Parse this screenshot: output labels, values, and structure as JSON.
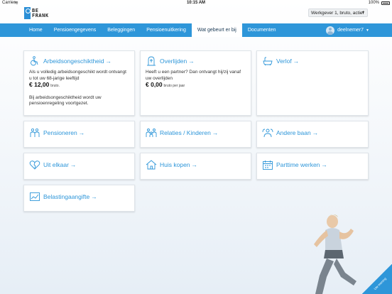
{
  "status_bar": {
    "carrier": "Carrier",
    "time": "10:15 AM",
    "battery": "100%"
  },
  "logo": {
    "line1": "BE",
    "line2": "FRANK"
  },
  "employer_select": {
    "value": "Werkgever 1, bruto, actief"
  },
  "nav": {
    "items": [
      "Home",
      "Pensioengegevens",
      "Beleggingen",
      "Pensioenuitkering",
      "Wat gebeurt er bij",
      "Documenten"
    ],
    "active_index": 4,
    "user": "deelnemer7"
  },
  "cards": {
    "arbeidsongeschiktheid": {
      "title": "Arbeidsongeschiktheid",
      "text1": "Als u volledig arbeidsongeschikt wordt ontvangt u tot uw 68-jarige leeftijd",
      "amount": "€ 12,00",
      "amount_note": "bruto.",
      "text2": "Bij arbeidsongeschiktheid wordt uw pensioenregeling voortgezet."
    },
    "overlijden": {
      "title": "Overlijden",
      "text1": "Heeft u een partner? Dan ontvangt hij/zij vanaf uw overlijden",
      "amount": "€ 0,00",
      "amount_note": "bruto per jaar"
    },
    "verlof": {
      "title": "Verlof"
    },
    "pensioneren": {
      "title": "Pensioneren"
    },
    "relaties": {
      "title": "Relaties / Kinderen"
    },
    "andere_baan": {
      "title": "Andere baan"
    },
    "uit_elkaar": {
      "title": "Uit elkaar"
    },
    "huis_kopen": {
      "title": "Huis kopen"
    },
    "parttime": {
      "title": "Parttime werken"
    },
    "belasting": {
      "title": "Belastingaangifte"
    }
  },
  "corner_badge": {
    "label": "Uw mening"
  },
  "colors": {
    "accent": "#2e96d9",
    "nav_bg": "#2e96d9"
  }
}
